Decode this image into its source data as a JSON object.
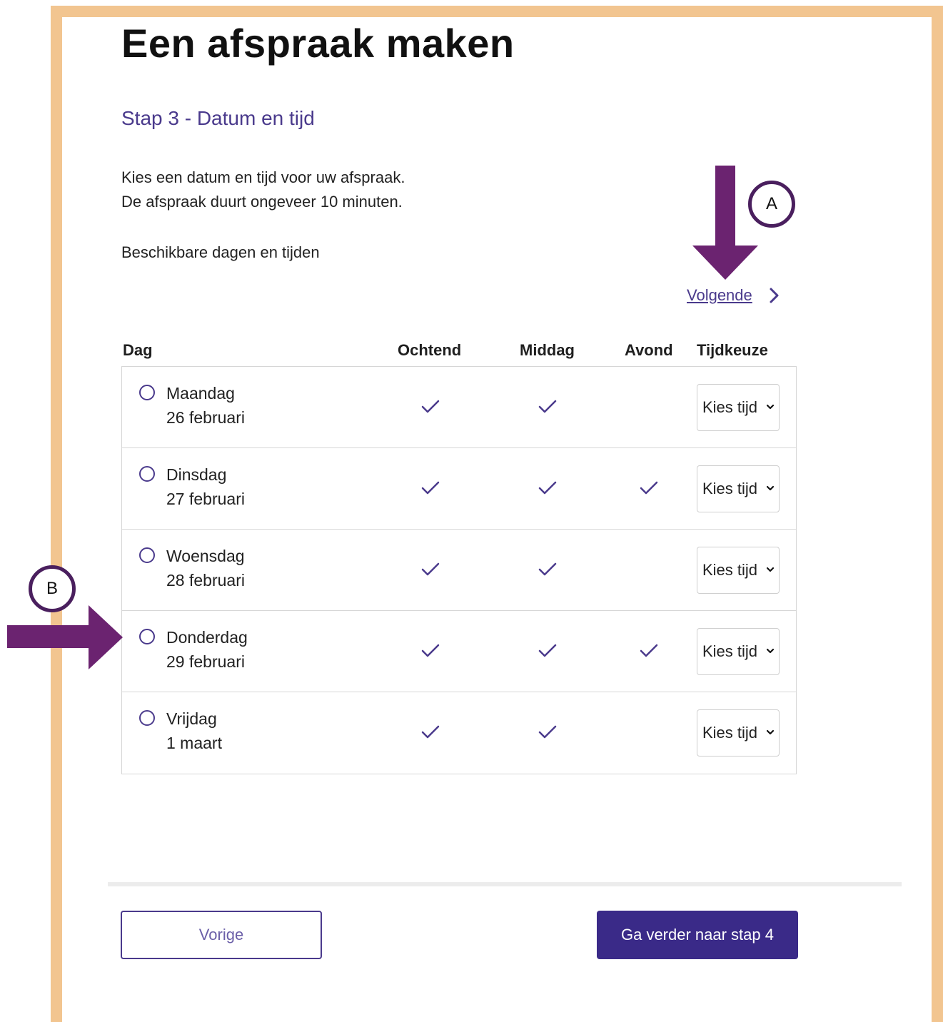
{
  "page": {
    "title": "Een afspraak maken",
    "step_title": "Stap 3 - Datum en tijd",
    "intro_line1": "Kies een datum en tijd voor uw afspraak.",
    "intro_line2": "De afspraak duurt ongeveer 10 minuten.",
    "available_label": "Beschikbare dagen en tijden",
    "next_link": "Volgende"
  },
  "table": {
    "headers": {
      "day": "Dag",
      "morning": "Ochtend",
      "afternoon": "Middag",
      "evening": "Avond",
      "time_choice": "Tijdkeuze"
    },
    "rows": [
      {
        "day": "Maandag",
        "date": "26 februari",
        "morning": true,
        "afternoon": true,
        "evening": false,
        "select": "Kies tijd"
      },
      {
        "day": "Dinsdag",
        "date": "27 februari",
        "morning": true,
        "afternoon": true,
        "evening": true,
        "select": "Kies tijd"
      },
      {
        "day": "Woensdag",
        "date": "28 februari",
        "morning": true,
        "afternoon": true,
        "evening": false,
        "select": "Kies tijd"
      },
      {
        "day": "Donderdag",
        "date": "29 februari",
        "morning": true,
        "afternoon": true,
        "evening": true,
        "select": "Kies tijd"
      },
      {
        "day": "Vrijdag",
        "date": "1 maart",
        "morning": true,
        "afternoon": true,
        "evening": false,
        "select": "Kies tijd"
      }
    ]
  },
  "buttons": {
    "previous": "Vorige",
    "continue": "Ga verder naar stap 4"
  },
  "annotations": {
    "marker_a": "A",
    "marker_b": "B"
  },
  "colors": {
    "accent": "#4a3a8c",
    "primary_button": "#3a2a88",
    "frame": "#f2c590",
    "annotation_arrow": "#6b2370"
  }
}
